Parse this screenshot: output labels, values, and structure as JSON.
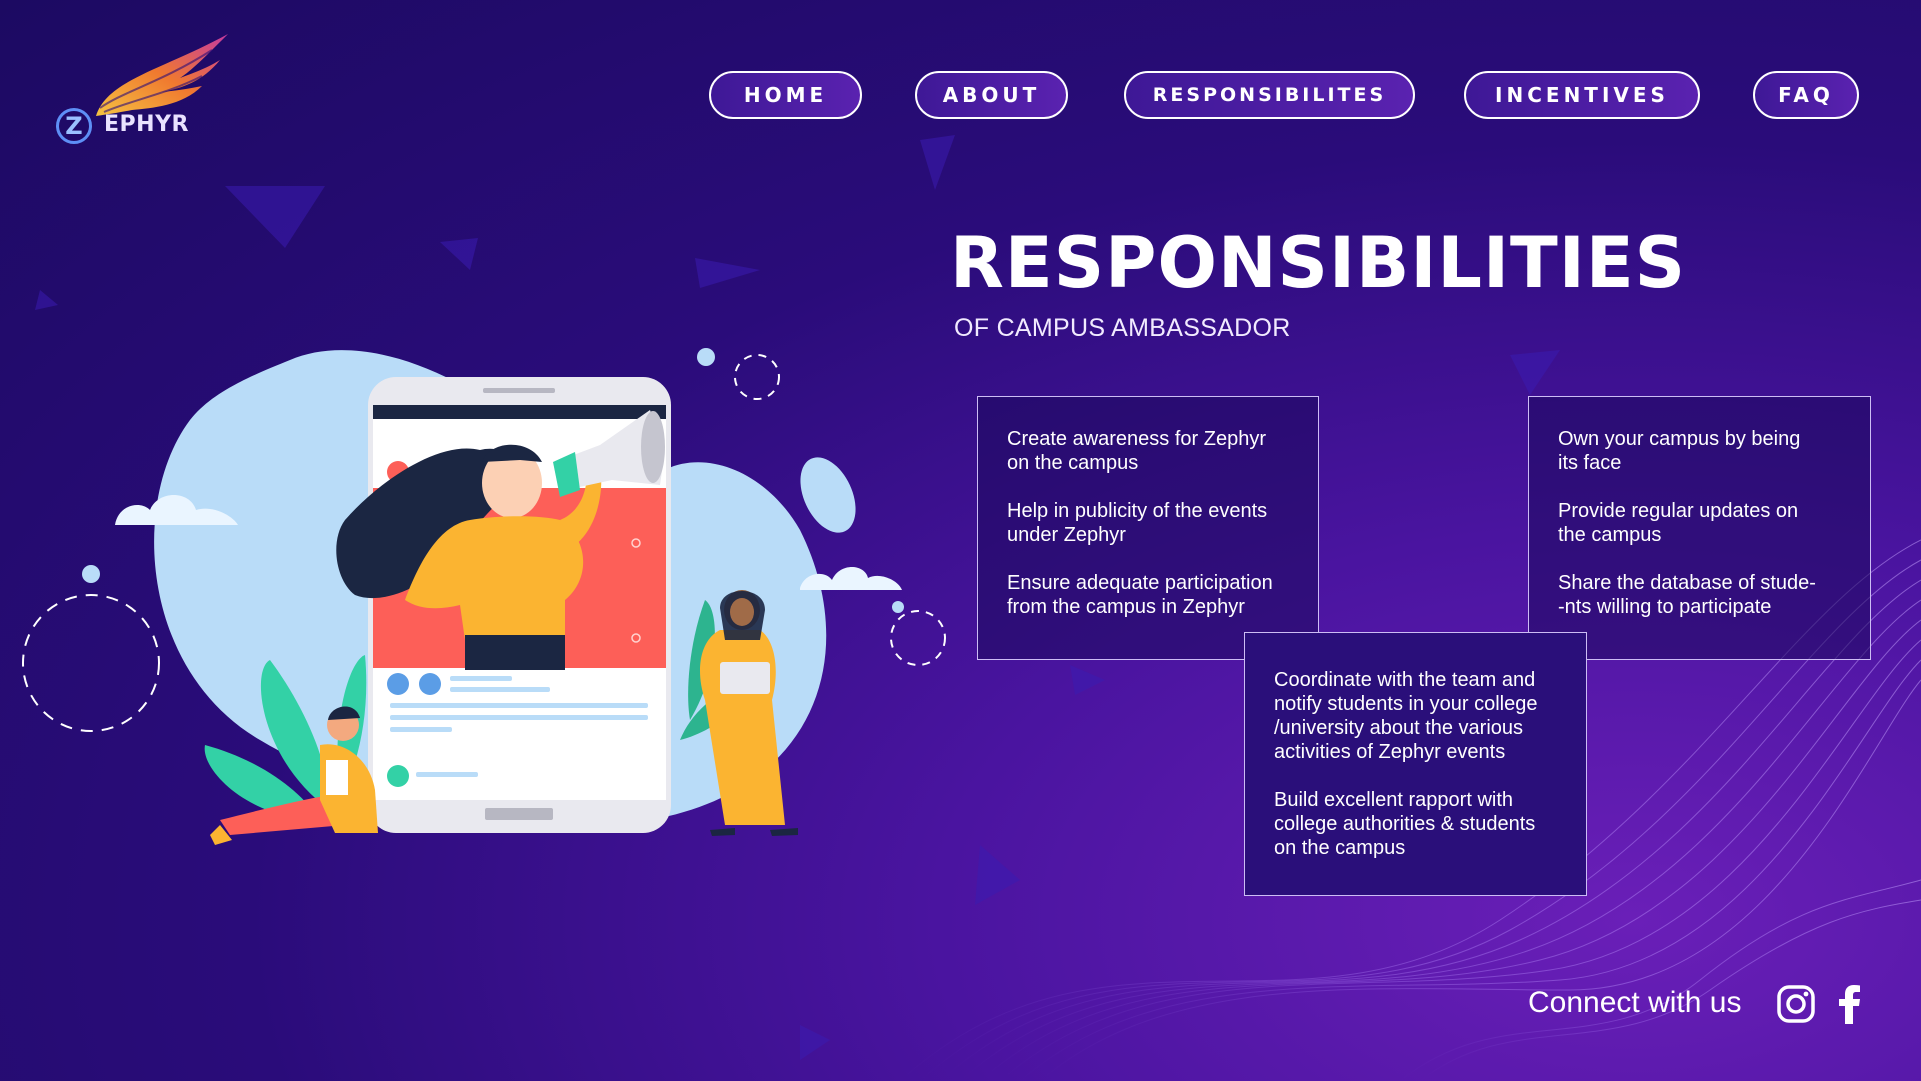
{
  "brand": {
    "logo_letter": "Z",
    "logo_text": "EPHYR"
  },
  "nav": {
    "items": [
      {
        "label": "HOME"
      },
      {
        "label": "ABOUT"
      },
      {
        "label": "RESPONSIBILITES"
      },
      {
        "label": "INCENTIVES"
      },
      {
        "label": "FAQ"
      }
    ]
  },
  "main": {
    "title": "RESPONSIBILITIES",
    "subtitle": "OF CAMPUS AMBASSADOR",
    "cards": [
      {
        "items": [
          "Create awareness for Zephyr\non the campus",
          "Help in publicity of the events\nunder Zephyr",
          "Ensure adequate participation\nfrom the campus in Zephyr"
        ]
      },
      {
        "items": [
          "Own your campus by being\nits face",
          "Provide regular updates on\nthe campus",
          "Share the database of stude-\n-nts willing to participate"
        ]
      },
      {
        "items": [
          "Coordinate with the team and\nnotify students in your college\n/university about the various\nactivities of Zephyr events",
          "Build excellent rapport with\ncollege authorities & students\non the campus"
        ]
      }
    ]
  },
  "footer": {
    "connect_label": "Connect with us",
    "social_icons": [
      "instagram-icon",
      "facebook-icon"
    ]
  },
  "colors": {
    "background": "#24097a",
    "accent_purple": "#5a22b0",
    "illustration_blue": "#b9dcf8",
    "illustration_red": "#fd5f58",
    "illustration_yellow": "#fbb431",
    "illustration_teal": "#33d1a6"
  }
}
